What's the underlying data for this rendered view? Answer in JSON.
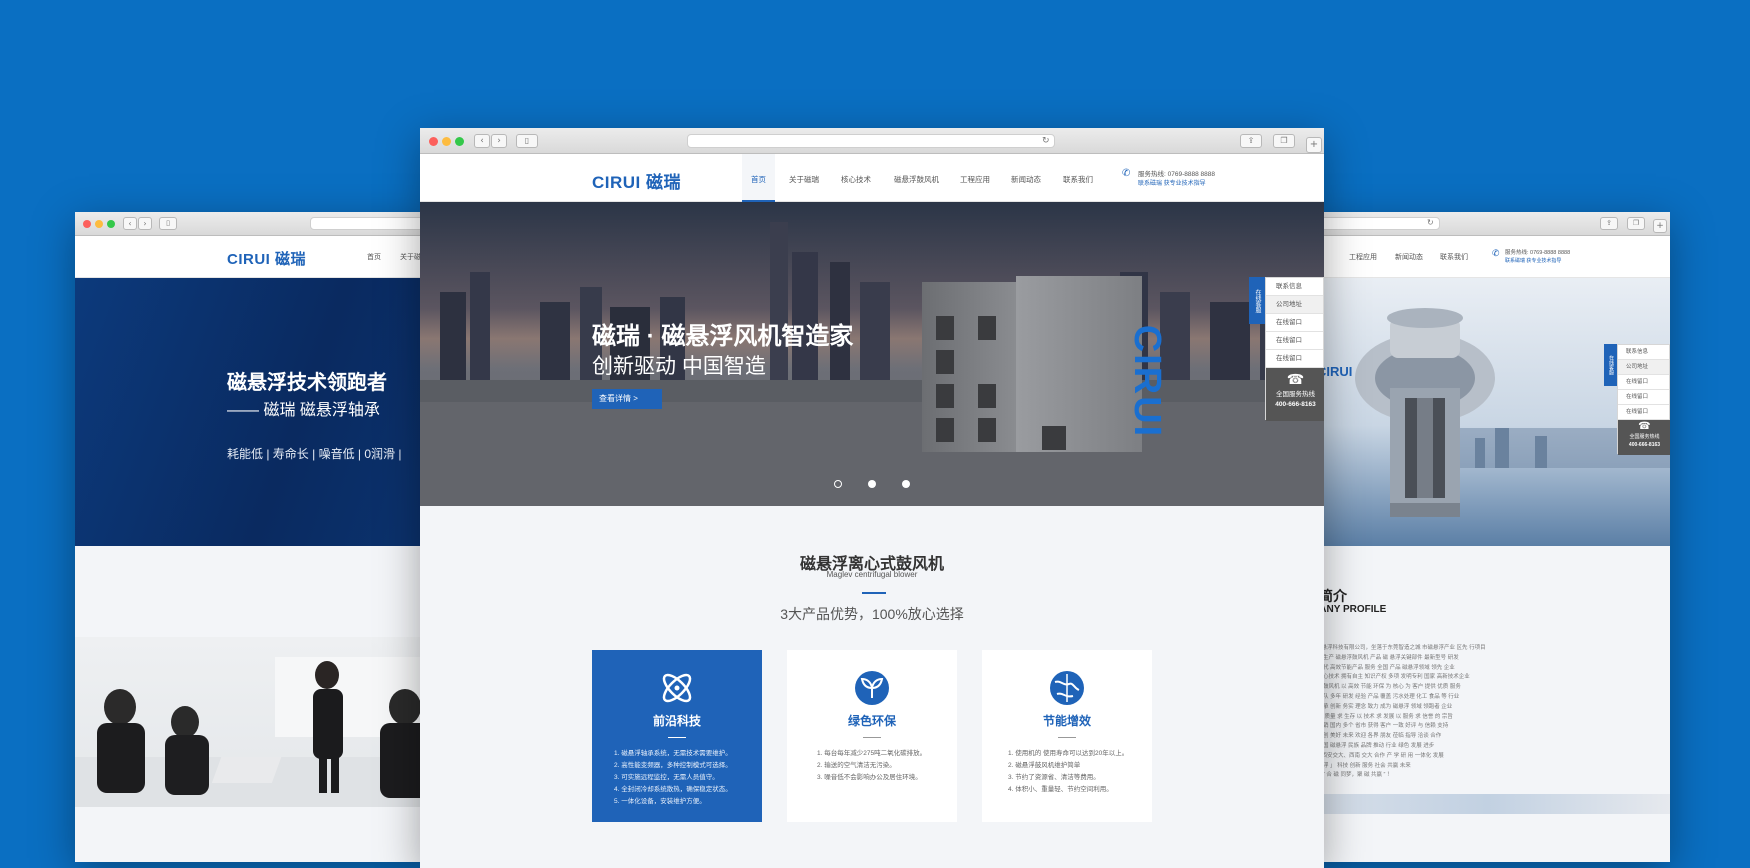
{
  "nav": {
    "logo_en": "CIRUI",
    "logo_cn": "磁瑞",
    "items": [
      "首页",
      "关于磁瑞",
      "核心技术",
      "磁悬浮鼓风机",
      "工程应用",
      "新闻动态",
      "联系我们"
    ],
    "phone_label": "服务热线: 0769-8888 8888",
    "phone_sub": "联系磁瑞 获专业技术指导"
  },
  "left": {
    "nav_items": [
      "首页",
      "关于磁"
    ],
    "hero_title": "磁悬浮技术领跑者",
    "hero_sub": "—— 磁瑞 磁悬浮轴承",
    "hero_tags": "耗能低 | 寿命长 | 噪音低 | 0润滑 |"
  },
  "center": {
    "hero_title": "磁瑞 · 磁悬浮风机智造家",
    "hero_sub": "创新驱动 中国智造",
    "hero_btn": "查看详情 >",
    "machine_brand": "CIRUI",
    "section_title": "磁悬浮离心式鼓风机",
    "section_en": "Maglev centrifugal blower",
    "section_sub": "3大产品优势，100%放心选择",
    "cards": [
      {
        "icon": "atom-icon",
        "title": "前沿科技",
        "items": [
          "1. 磁悬浮轴承系统，无需技术需要维护。",
          "2. 高性能变频器，多种控制模式可选择。",
          "3. 可实施远程监控，无需人员值守。",
          "4. 全封闭冷却系统散热，确保稳定状态。",
          "5. 一体化设备，安装维护方便。"
        ]
      },
      {
        "icon": "leaf-icon",
        "title": "绿色环保",
        "items": [
          "1. 每台每年减少275吨二氧化碳排放。",
          "2. 输送的空气清洁无污染。",
          "3. 噪音低不会影响办公及居住环境。"
        ]
      },
      {
        "icon": "globe-icon",
        "title": "节能增效",
        "items": [
          "1. 使用机的 使用寿命可以达到20年以上。",
          "2. 磁悬浮鼓风机维护简单",
          "3. 节约了资源省、清洁等费用。",
          "4. 体积小、重量轻、节约空间利用。"
        ]
      }
    ]
  },
  "side": {
    "tab": "在线客服",
    "rows": [
      "联系信息",
      "公司地址",
      "在线留口",
      "在线留口",
      "在线留口"
    ],
    "hotline_label": "全国服务热线",
    "hotline": "400-666-8163"
  },
  "right": {
    "nav_items": [
      "工程应用",
      "新闻动态",
      "联系我们"
    ],
    "phone_label": "服务热线: 0769-8888 8888",
    "phone_sub": "联系磁瑞 获专业技术指导",
    "brand": "CIRUI",
    "profile_cn": "业简介",
    "profile_en": "MPANY PROFILE",
    "profile_lines": [
      "磁瑞磁悬浮科技有限公司，坐落于东莞智造之城 市磁悬浮产业 区先 行项目",
      "本 公司生产 磁悬浮鼓风机 产品 磁 悬浮关键部件 最新型号 研发",
      "的 新一代 高效节能产品 服务 全国 产品 磁悬浮领域 领先 企业",
      "产品 核心技术 拥有自主 知识产权 多项 发明专利 国家 高新技术企业",
      "磁悬浮 鼓风机 以 高效 节能 环保 为 核心 为 客户 提供 优质 服务",
      "技术 团队 多年 研发 经验 产品 覆盖 污水处理 化工 食品 等 行业",
      "公司 秉承 创新 务实 理念 致力 成为 磁悬浮 领域 领跑者 企业",
      "坚持 以 质量 求 生存 以 技术 求 发展 以 服务 求 信誉 的 宗旨",
      "产品 远销 国内 多个 省市 获得 客户 一致 好评 与 信赖 支持",
      "携手 共创 美好 未来 欢迎 各界 朋友 莅临 指导 洽谈 合作",
      "打造 中国 磁悬浮 民族 品牌 推动 行业 绿色 发展 进步",
      "大学、西安交大、西南 交大 合作 产 学 研 用 一体化 发展",
      "「 磁悬浮 」 科技 创新 服务 社会 共赢 未来",
      "新时代 “ 合 磁 同梦，聚 磁 共赢 ” ！"
    ]
  }
}
